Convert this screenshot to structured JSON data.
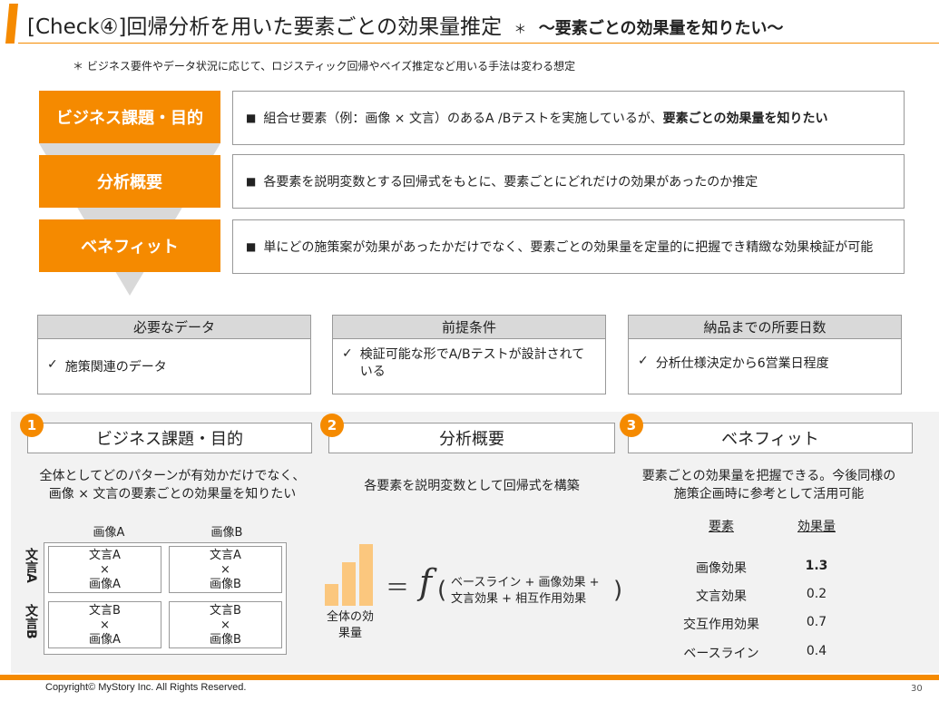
{
  "header": {
    "title": "[Check④]回帰分析を用いた要素ごとの効果量推定",
    "title_suffix": "＊",
    "subtitle": "～要素ごとの効果量を知りたい～"
  },
  "note": "＊ ビジネス要件やデータ状況に応じて、ロジスティック回帰やベイズ推定など用いる手法は変わる想定",
  "rows": [
    {
      "label": "ビジネス課題・目的",
      "text": "組合せ要素（例：画像 × 文言）のあるA /Bテストを実施しているが、",
      "bold": "要素ごとの効果量を知りたい"
    },
    {
      "label": "分析概要",
      "text": "各要素を説明変数とする回帰式をもとに、要素ごとにどれだけの効果があったのか推定",
      "bold": ""
    },
    {
      "label": "ベネフィット",
      "text": "単にどの施策案が効果があったかだけでなく、要素ごとの効果量を定量的に把握でき精緻な効果検証が可能",
      "bold": ""
    }
  ],
  "bullet": "■",
  "cards": [
    {
      "title": "必要なデータ",
      "check": "✓",
      "text": "施策関連のデータ"
    },
    {
      "title": "前提条件",
      "check": "✓",
      "text": "検証可能な形でA/Bテストが設計されている"
    },
    {
      "title": "納品までの所要日数",
      "check": "✓",
      "text": "分析仕様決定から6営業日程度"
    }
  ],
  "sections": [
    {
      "num": "1",
      "title": "ビジネス課題・目的",
      "desc": "全体としてどのパターンが有効かだけでなく、画像 × 文言の要素ごとの効果量を知りたい"
    },
    {
      "num": "2",
      "title": "分析概要",
      "desc": "各要素を説明変数として回帰式を構築"
    },
    {
      "num": "3",
      "title": "ベネフィット",
      "desc": "要素ごとの効果量を把握できる。今後同様の施策企画時に参考として活用可能"
    }
  ],
  "grid": {
    "col_a": "画像A",
    "col_b": "画像B",
    "row_a": "文言A",
    "row_b": "文言B",
    "cells": [
      [
        "文言A",
        "×",
        "画像A"
      ],
      [
        "文言A",
        "×",
        "画像B"
      ],
      [
        "文言B",
        "×",
        "画像A"
      ],
      [
        "文言B",
        "×",
        "画像B"
      ]
    ]
  },
  "formula": {
    "lhs_label": "全体の効果量",
    "equals": "＝",
    "f": "f",
    "line1": "ベースライン + 画像効果 +",
    "line2": "文言効果 + 相互作用効果"
  },
  "effects": {
    "head_key": "要素",
    "head_val": "効果量",
    "rows": [
      {
        "k": "画像効果",
        "v": "1.3"
      },
      {
        "k": "文言効果",
        "v": "0.2"
      },
      {
        "k": "交互作用効果",
        "v": "0.7"
      },
      {
        "k": "ベースライン",
        "v": "0.4"
      }
    ]
  },
  "footer": {
    "copyright": "Copyright© MyStory Inc. All Rights Reserved.",
    "page": "30"
  },
  "colors": {
    "accent": "#f58a00",
    "panel": "#f2f2f2",
    "card_head": "#d9d9d9"
  }
}
